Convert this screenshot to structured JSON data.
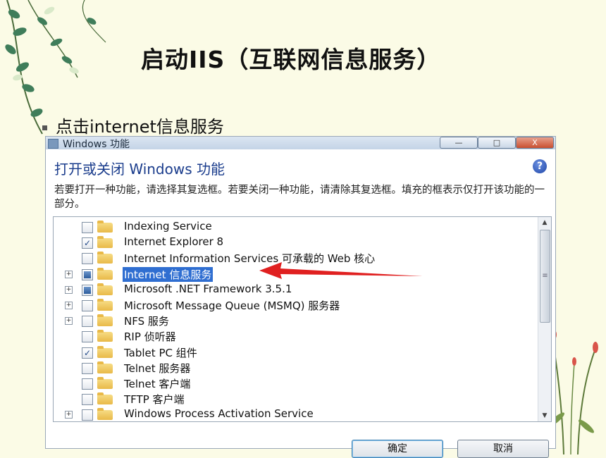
{
  "slide": {
    "title": "启动IIS（互联网信息服务）",
    "bullet": "点击internet信息服务"
  },
  "dialog": {
    "window_title": "Windows 功能",
    "controls": {
      "minimize": "—",
      "maximize": "□",
      "close": "X"
    },
    "heading": "打开或关闭 Windows 功能",
    "help_icon": "?",
    "description": "若要打开一种功能，请选择其复选框。若要关闭一种功能，请清除其复选框。填充的框表示仅打开该功能的一部分。",
    "features": [
      {
        "label": "Indexing Service",
        "state": "unchecked",
        "expandable": false
      },
      {
        "label": "Internet Explorer 8",
        "state": "checked",
        "expandable": false
      },
      {
        "label": "Internet Information Services 可承载的 Web 核心",
        "state": "unchecked",
        "expandable": false
      },
      {
        "label": "Internet 信息服务",
        "state": "partial",
        "expandable": true,
        "selected": true
      },
      {
        "label": "Microsoft .NET Framework 3.5.1",
        "state": "partial",
        "expandable": true
      },
      {
        "label": "Microsoft Message Queue (MSMQ) 服务器",
        "state": "unchecked",
        "expandable": true
      },
      {
        "label": "NFS 服务",
        "state": "unchecked",
        "expandable": true
      },
      {
        "label": "RIP 侦听器",
        "state": "unchecked",
        "expandable": false
      },
      {
        "label": "Tablet PC 组件",
        "state": "checked",
        "expandable": false
      },
      {
        "label": "Telnet 服务器",
        "state": "unchecked",
        "expandable": false
      },
      {
        "label": "Telnet 客户端",
        "state": "unchecked",
        "expandable": false
      },
      {
        "label": "TFTP 客户端",
        "state": "unchecked",
        "expandable": false
      },
      {
        "label": "Windows Process Activation Service",
        "state": "unchecked",
        "expandable": true
      }
    ],
    "ok_label": "确定",
    "cancel_label": "取消"
  },
  "colors": {
    "accent": "#2f6ed1",
    "arrow": "#e02020",
    "heading": "#1a3c8c"
  }
}
